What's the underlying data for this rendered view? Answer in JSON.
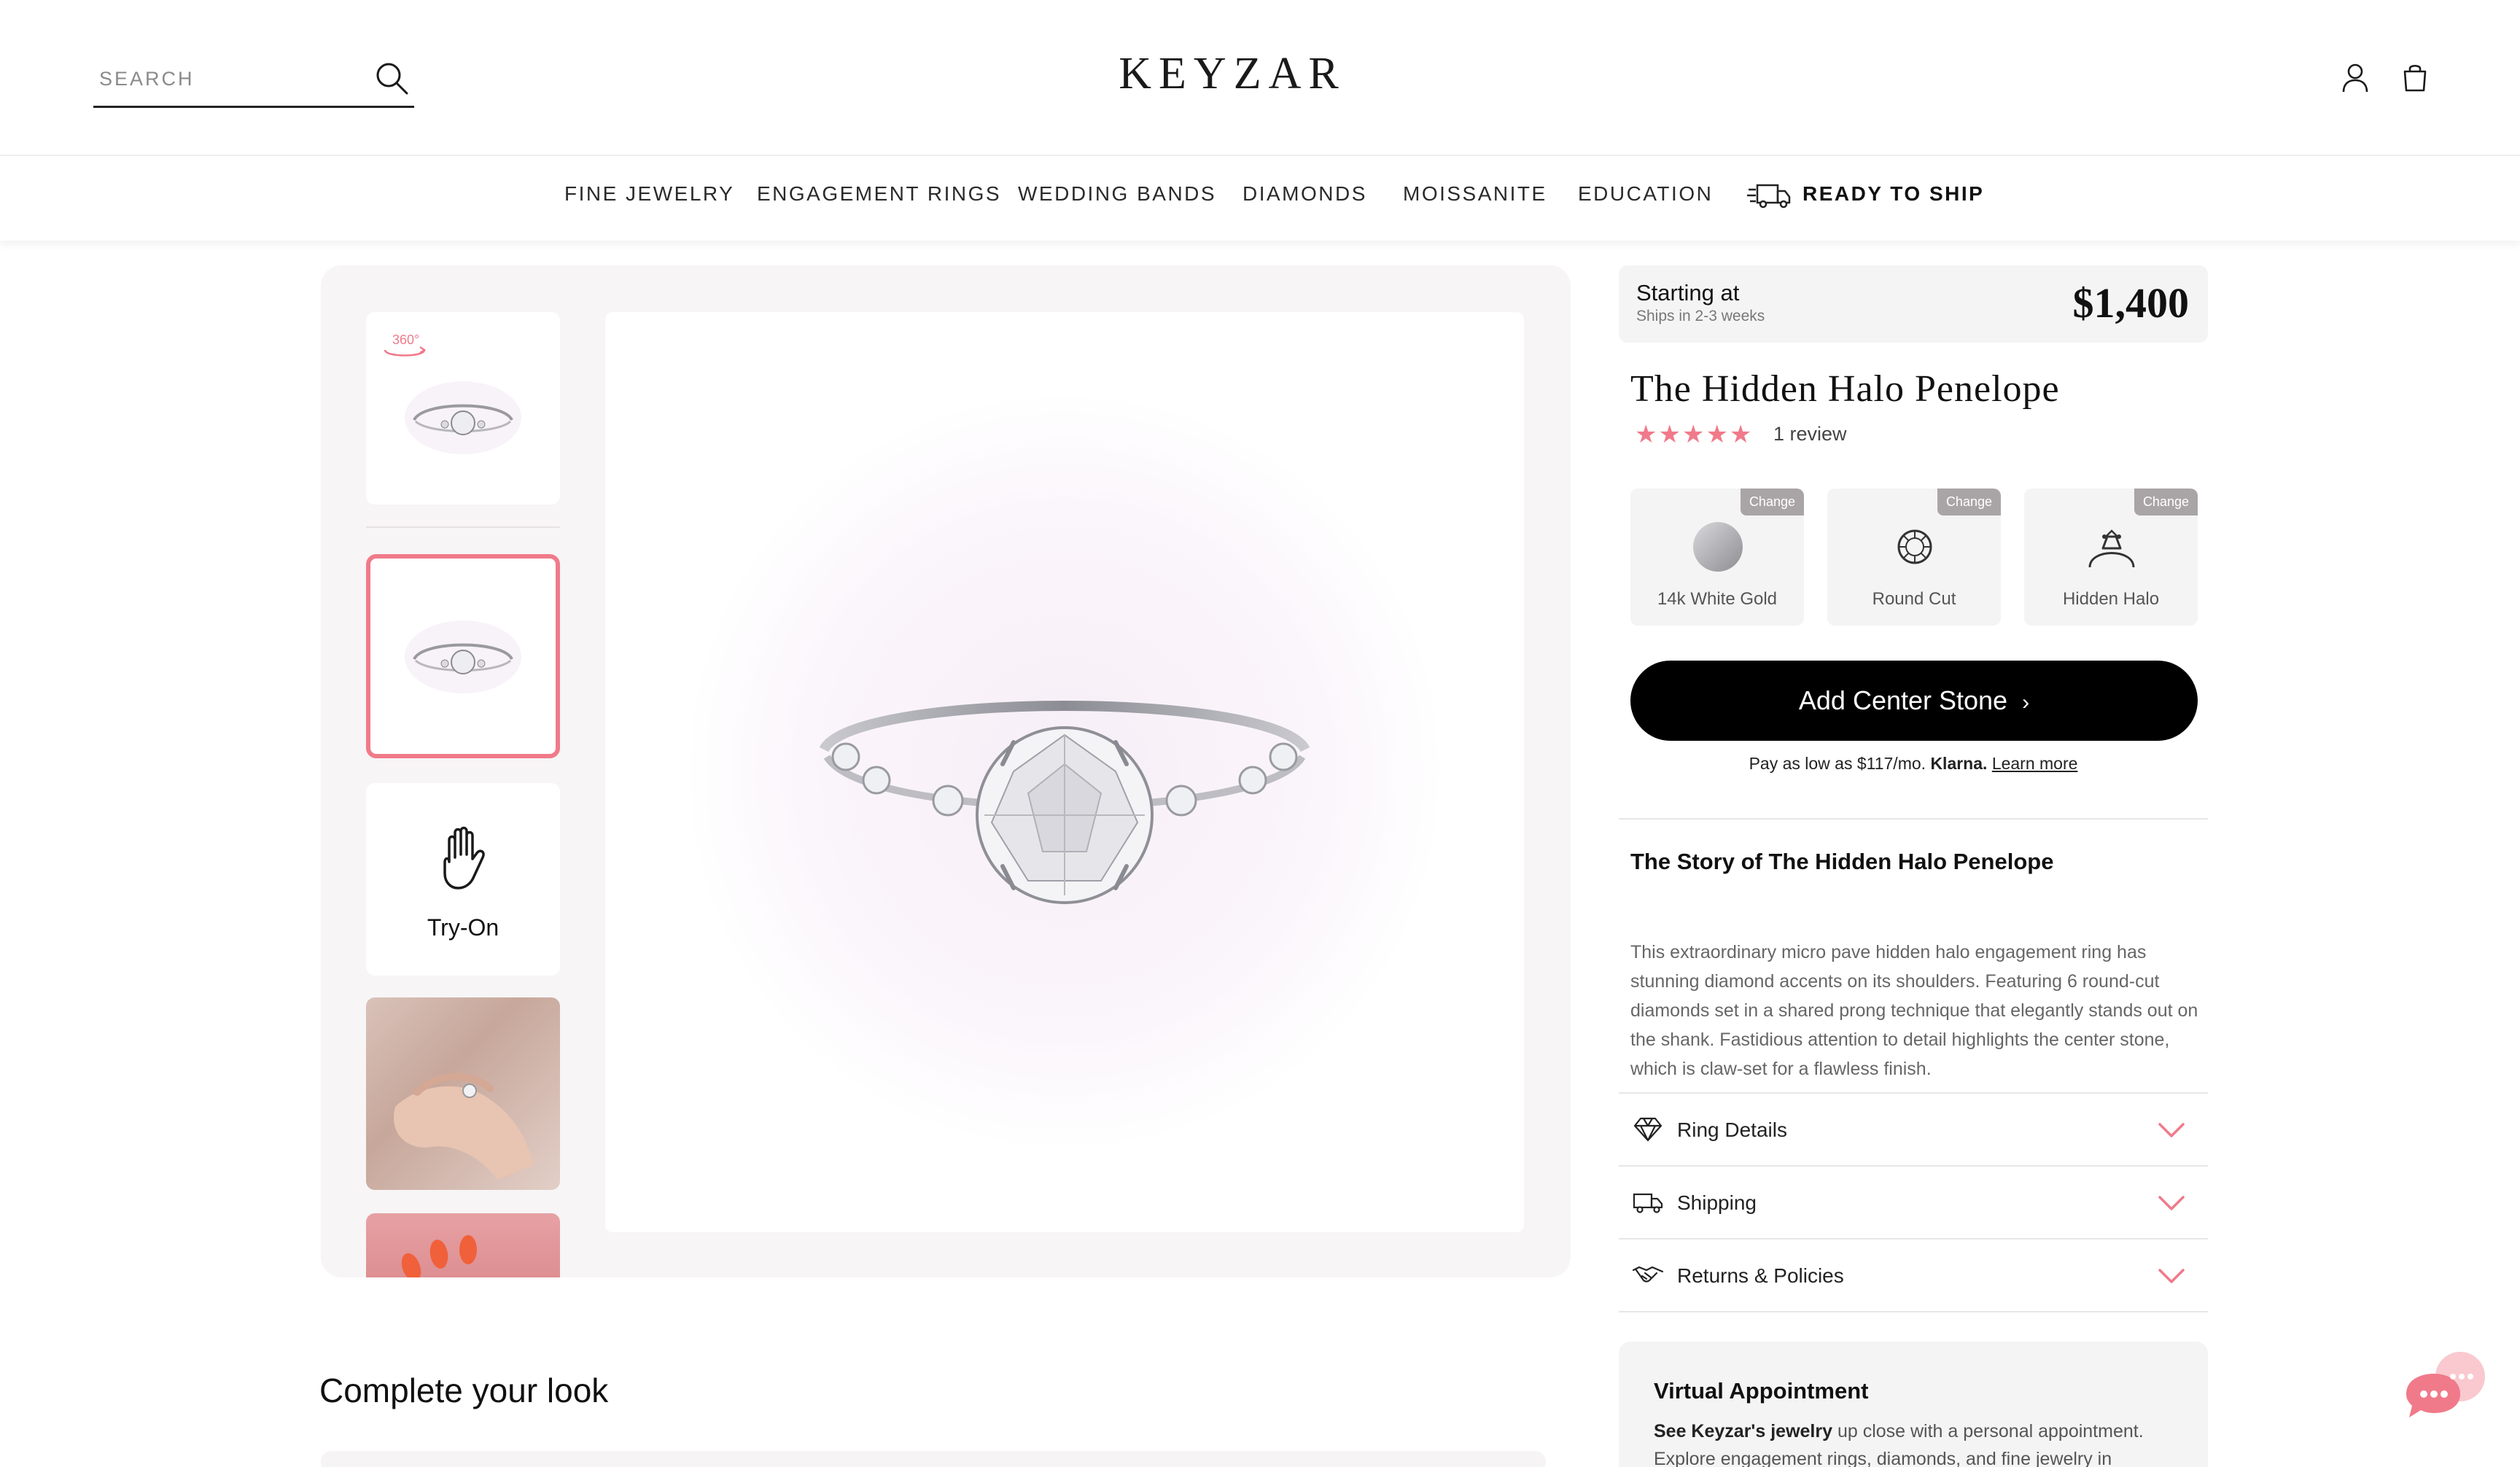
{
  "header": {
    "search_placeholder": "SEARCH",
    "logo": "KEYZAR"
  },
  "nav": {
    "items": [
      "FINE JEWELRY",
      "ENGAGEMENT RINGS",
      "WEDDING BANDS",
      "DIAMONDS",
      "MOISSANITE",
      "EDUCATION"
    ],
    "ready_to_ship": "READY TO SHIP"
  },
  "gallery": {
    "badge_360": "360°",
    "tryon_label": "Try-On"
  },
  "product": {
    "starting_label": "Starting at",
    "ships_label": "Ships in 2-3 weeks",
    "price": "$1,400",
    "title": "The Hidden Halo Penelope",
    "stars": "★★★★★",
    "rating": 5,
    "reviews": "1 review",
    "options": [
      {
        "label": "14k White Gold",
        "change": "Change",
        "icon": "metal-swatch-icon"
      },
      {
        "label": "Round Cut",
        "change": "Change",
        "icon": "round-cut-diamond-icon"
      },
      {
        "label": "Hidden Halo",
        "change": "Change",
        "icon": "hidden-halo-ring-icon"
      }
    ],
    "cta": "Add Center Stone",
    "klarna": {
      "prefix": "Pay as low as $117/mo.",
      "brand": "Klarna.",
      "link": "Learn more"
    },
    "story_heading": "The Story of The Hidden Halo Penelope",
    "story_text": "This extraordinary micro pave hidden halo engagement ring has stunning diamond accents on its shoulders. Featuring 6 round-cut diamonds set in a shared prong technique that elegantly stands out on the shank. Fastidious attention to detail highlights the center stone, which is claw-set for a flawless finish.",
    "accordions": [
      "Ring Details",
      "Shipping",
      "Returns & Policies"
    ]
  },
  "virtual": {
    "heading": "Virtual Appointment",
    "bold": "See Keyzar's jewelry",
    "text": " up close with a personal appointment. Explore engagement rings, diamonds, and fine jewelry in"
  },
  "complete_look": "Complete your look",
  "colors": {
    "accent": "#f07a8a",
    "cta_bg": "#000000",
    "panel_bg": "#f5f4f4"
  }
}
